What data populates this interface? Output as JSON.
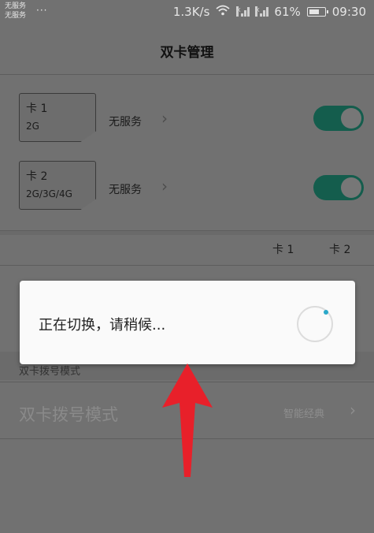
{
  "status_bar": {
    "sim_line_1": "无服务",
    "sim_line_2": "无服务",
    "dots": "···",
    "speed": "1.3K/s",
    "battery": "61%",
    "time": "09:30"
  },
  "header": {
    "title": "双卡管理"
  },
  "sims": [
    {
      "name": "卡 1",
      "network": "2G",
      "service": "无服务",
      "enabled": true
    },
    {
      "name": "卡 2",
      "network": "2G/3G/4G",
      "service": "无服务",
      "enabled": true
    }
  ],
  "columns": {
    "card1": "卡 1",
    "card2": "卡 2"
  },
  "dial_section": {
    "header": "双卡拨号模式",
    "title": "双卡拨号模式",
    "value": "智能经典"
  },
  "dialog": {
    "message": "正在切换，请稍候..."
  },
  "colors": {
    "toggle": "#145d4d",
    "arrow": "#e8202a",
    "spinner_dot": "#2aa8c9"
  },
  "icons": {
    "wifi": "wifi-icon",
    "chevron": "chevron-right-icon",
    "arrow": "red-up-arrow-annotation"
  }
}
